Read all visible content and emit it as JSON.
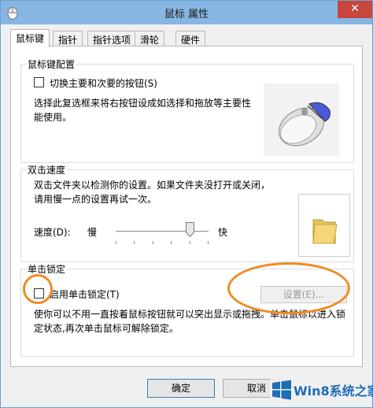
{
  "window": {
    "title": "鼠标 属性",
    "close_glyph": "✕"
  },
  "tabs": [
    {
      "label": "鼠标键"
    },
    {
      "label": "指针"
    },
    {
      "label": "指针选项"
    },
    {
      "label": "滑轮"
    },
    {
      "label": "硬件"
    }
  ],
  "button_config": {
    "group_title": "鼠标键配置",
    "switch_label": "切换主要和次要的按钮(S)",
    "switch_checked": false,
    "description": "选择此复选框来将右按钮设成如选择和拖放等主要性能使用。"
  },
  "double_click": {
    "group_title": "双击速度",
    "description": "双击文件夹以检测你的设置。如果文件夹没打开或关闭，请用慢一点的设置再试一次。",
    "speed_label": "速度(D):",
    "slow_label": "慢",
    "fast_label": "快",
    "speed_level_fraction": 0.8
  },
  "click_lock": {
    "group_title": "单击锁定",
    "enable_label": "启用单击锁定(T)",
    "enable_checked": false,
    "settings_label": "设置(E)...",
    "description": "使你可以不用一直按着鼠标按钮就可以突出显示或拖拽。单击鼠标以进入锁定状态,再次单击鼠标可解除锁定。"
  },
  "footer": {
    "ok_label": "确定",
    "cancel_label": "取消"
  },
  "watermark": {
    "text": "Win8系统之家"
  },
  "colors": {
    "titlebar": "#87b6e4",
    "close": "#c7463d",
    "highlight": "#f08a24"
  }
}
